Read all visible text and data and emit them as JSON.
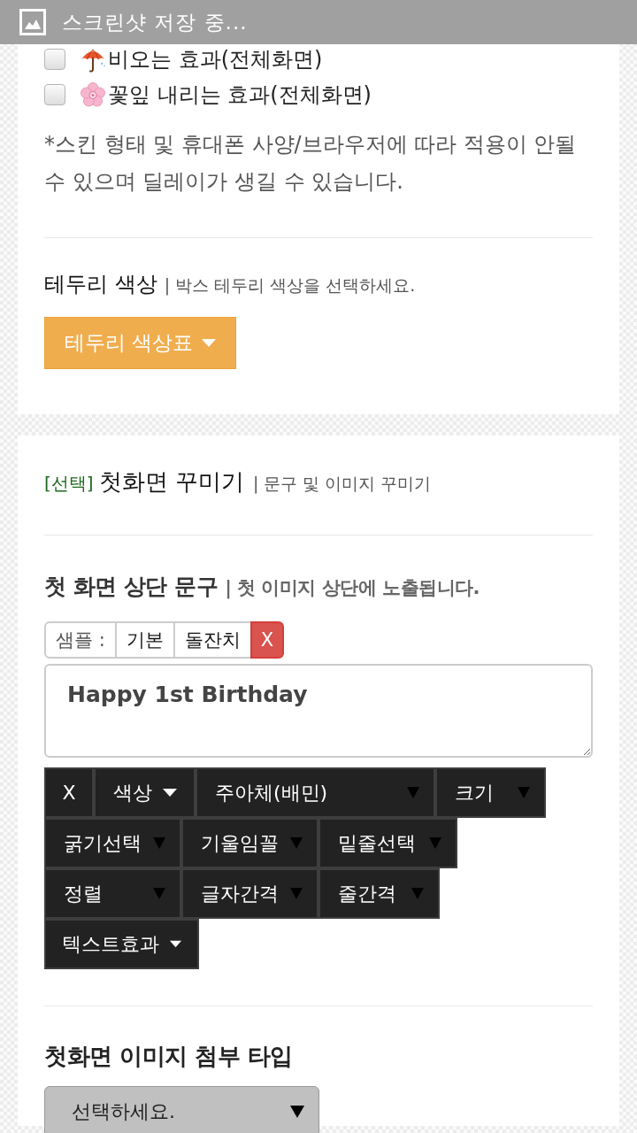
{
  "notification": {
    "text": "스크린샷 저장 중..."
  },
  "effects_card": {
    "options": [
      {
        "label": "비오는 효과(전체화면)",
        "checked": false
      },
      {
        "label": "꽃잎 내리는 효과(전체화면)",
        "checked": false
      }
    ],
    "note": "*스킨 형태 및 휴대폰 사양/브라우저에 따라 적용이 안될 수 있으며 딜레이가 생길 수 있습니다.",
    "border_color": {
      "label": "테두리 색상",
      "hint": "| 박스 테두리 색상을 선택하세요.",
      "button": "테두리 색상표"
    }
  },
  "intro_card": {
    "tag": "[선택]",
    "title": "첫화면 꾸미기",
    "subtitle": "| 문구 및 이미지 꾸미기",
    "top_text": {
      "label": "첫 화면 상단 문구",
      "hint": "| 첫 이미지 상단에 노출됩니다.",
      "samples": {
        "label": "샘플 :",
        "items": [
          "기본",
          "돌잔치"
        ],
        "clear": "X"
      },
      "value": "Happy 1st Birthday",
      "toolbar": [
        [
          {
            "kind": "button",
            "label": "X"
          },
          {
            "kind": "menu",
            "label": "색상"
          },
          {
            "kind": "select",
            "label": "주아체(배민)"
          },
          {
            "kind": "select",
            "label": "크기"
          }
        ],
        [
          {
            "kind": "select",
            "label": "굵기선택"
          },
          {
            "kind": "select",
            "label": "기울임꼴"
          },
          {
            "kind": "select",
            "label": "밑줄선택"
          }
        ],
        [
          {
            "kind": "select",
            "label": "정렬"
          },
          {
            "kind": "select",
            "label": "글자간격"
          },
          {
            "kind": "select",
            "label": "줄간격"
          }
        ],
        [
          {
            "kind": "menu",
            "label": "텍스트효과"
          }
        ]
      ]
    },
    "image_type": {
      "label": "첫화면 이미지 첨부 타입",
      "select": "선택하세요."
    }
  }
}
